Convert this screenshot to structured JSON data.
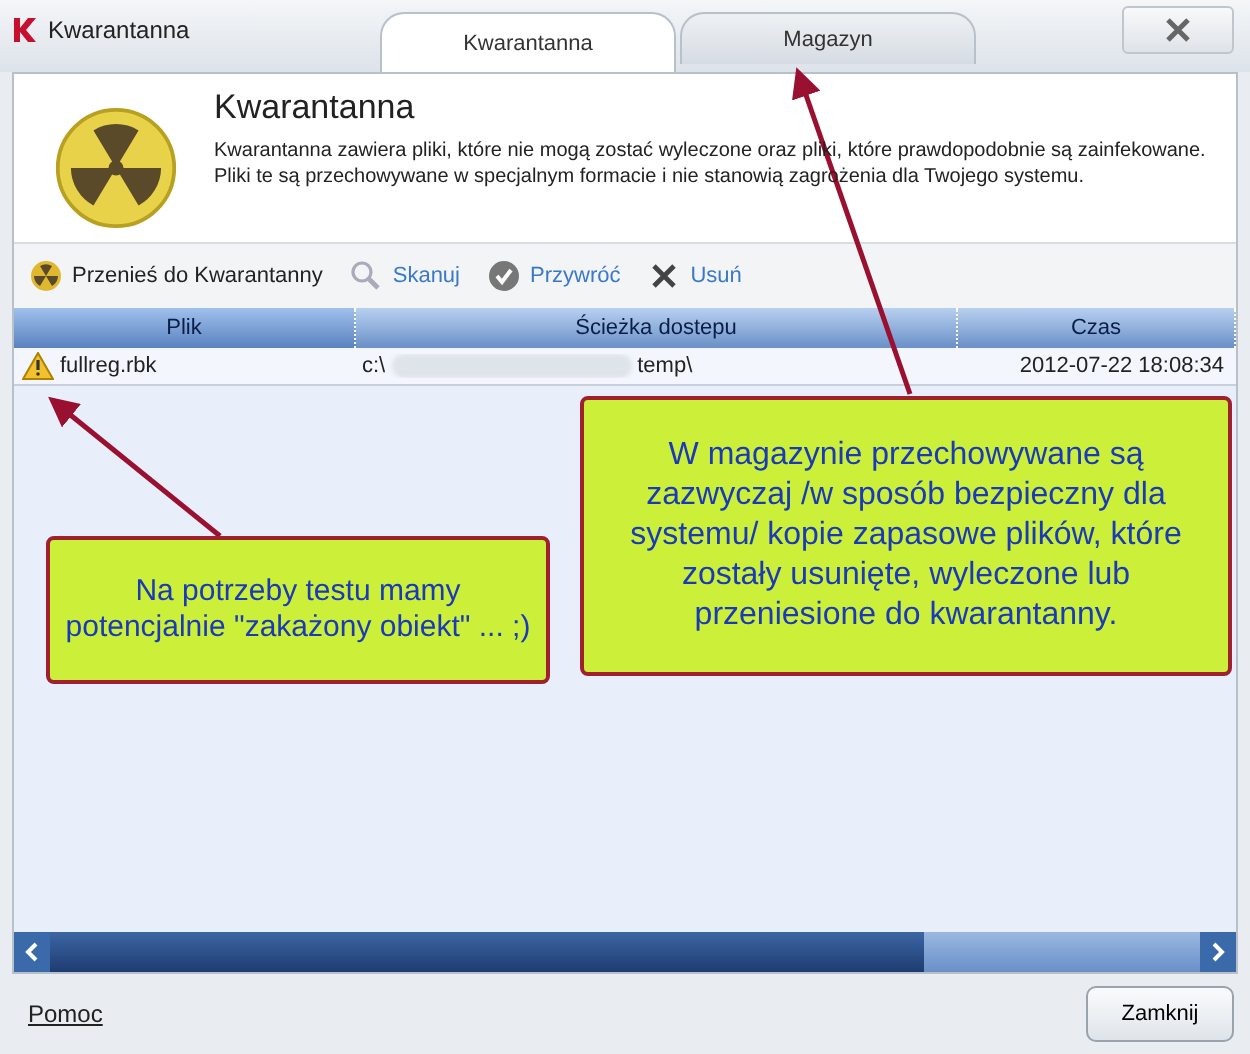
{
  "window": {
    "title": "Kwarantanna"
  },
  "tabs": [
    {
      "label": "Kwarantanna",
      "selected": true
    },
    {
      "label": "Magazyn",
      "selected": false
    }
  ],
  "header": {
    "title": "Kwarantanna",
    "description": "Kwarantanna zawiera pliki, które nie mogą zostać wyleczone oraz pliki, które prawdopodobnie są zainfekowane. Pliki te są przechowywane w specjalnym formacie i nie stanowią zagrożenia dla Twojego systemu."
  },
  "toolbar": [
    {
      "kind": "primary",
      "label": "Przenieś do Kwarantanny"
    },
    {
      "kind": "link",
      "label": "Skanuj"
    },
    {
      "kind": "link",
      "label": "Przywróć"
    },
    {
      "kind": "link",
      "label": "Usuń"
    }
  ],
  "table": {
    "columns": [
      "Plik",
      "Ścieżka dostepu",
      "Czas"
    ],
    "rows": [
      {
        "file": "fullreg.rbk",
        "path_start": "c:\\",
        "path_end": "temp\\",
        "time": "2012-07-22 18:08:34"
      }
    ]
  },
  "footer": {
    "help": "Pomoc",
    "close": "Zamknij"
  },
  "callouts": [
    {
      "text": "Na potrzeby testu mamy potencjalnie \"zakażony obiekt\" ... ;)"
    },
    {
      "text": "W magazynie przechowywane są zazwyczaj /w sposób bezpieczny dla systemu/ kopie zapasowe plików, które zostały usunięte, wyleczone lub przeniesione do kwarantanny."
    }
  ]
}
